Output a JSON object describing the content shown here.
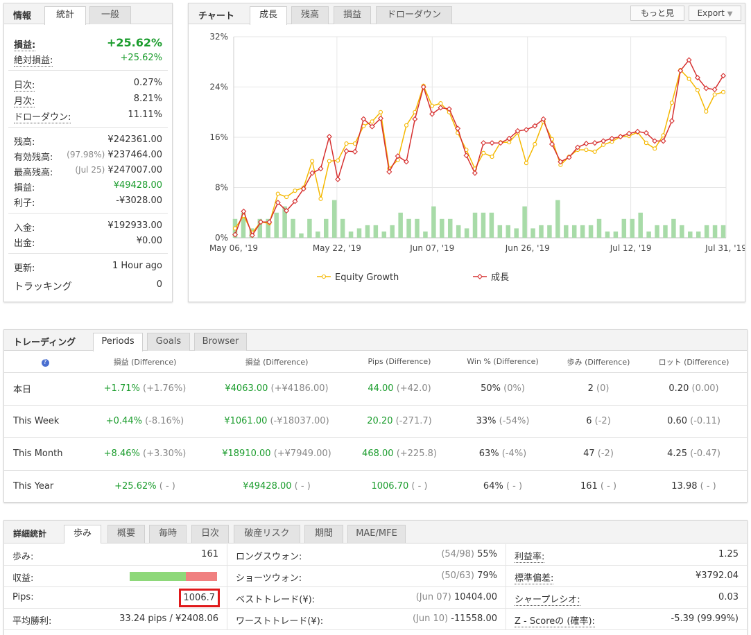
{
  "info": {
    "title": "情報",
    "tabs": [
      "統計",
      "一般"
    ],
    "gain_label": "損益:",
    "gain_value": "+25.62%",
    "abs_gain_label": "絶対損益:",
    "abs_gain_value": "+25.62%",
    "daily_label": "日次:",
    "daily_value": "0.27%",
    "monthly_label": "月次:",
    "monthly_value": "8.21%",
    "drawdown_label": "ドローダウン:",
    "drawdown_value": "11.11%",
    "balance_label": "残高:",
    "balance_value": "¥242361.00",
    "equity_label": "有効残高:",
    "equity_note": "(97.98%)",
    "equity_value": "¥237464.00",
    "highest_label": "最高残高:",
    "highest_note": "(Jul 25)",
    "highest_value": "¥247007.00",
    "profit_label": "損益:",
    "profit_value": "¥49428.00",
    "interest_label": "利子:",
    "interest_value": "-¥3028.00",
    "deposits_label": "入金:",
    "deposits_value": "¥192933.00",
    "withdrawals_label": "出金:",
    "withdrawals_value": "¥0.00",
    "updated_label": "更新:",
    "updated_value": "1 Hour ago",
    "tracking_label": "トラッキング",
    "tracking_value": "0"
  },
  "chart_panel": {
    "title": "チャート",
    "tabs": [
      "成長",
      "残高",
      "損益",
      "ドローダウン"
    ],
    "more_label": "もっと見",
    "export_label": "Export",
    "export_arrow": "▼"
  },
  "chart_data": {
    "type": "line",
    "ylim": [
      0,
      32
    ],
    "yticks": [
      "0%",
      "8%",
      "16%",
      "24%",
      "32%"
    ],
    "xtick_labels": [
      "May 06, '19",
      "May 22, '19",
      "Jun 07, '19",
      "Jun 26, '19",
      "Jul 12, '19",
      "Jul 31, '19"
    ],
    "xtick_index": [
      0,
      13,
      25,
      37,
      50,
      62
    ],
    "point_count": 63,
    "series": [
      {
        "name": "Equity Growth",
        "color": "#f5b800",
        "values": [
          1.5,
          3.5,
          0.8,
          2.5,
          2.3,
          7,
          6.5,
          7.5,
          8,
          12.2,
          6.2,
          12.2,
          12.3,
          15,
          15,
          17.8,
          18.5,
          20,
          11,
          12.4,
          17.9,
          20,
          24.2,
          21,
          21.4,
          20,
          16.7,
          14,
          11,
          13.5,
          12.9,
          15.2,
          15.2,
          16.7,
          11.9,
          14.9,
          18.5,
          15.7,
          11.6,
          12.9,
          14,
          14,
          13.7,
          14.8,
          15.3,
          16.1,
          16.2,
          16.8,
          15.1,
          14.2,
          16.3,
          21.5,
          26.7,
          25.3,
          23.5,
          20.1,
          22.8,
          23.2
        ]
      },
      {
        "name": "成長",
        "color": "#d63030",
        "values": [
          0.5,
          4.2,
          0.4,
          2.5,
          2.5,
          5.6,
          4.3,
          5.8,
          7.8,
          10.3,
          11,
          16.1,
          9.3,
          13.8,
          13.7,
          18.9,
          17.7,
          19,
          10.5,
          13,
          12.1,
          18.9,
          24,
          19.7,
          20.7,
          20.5,
          17.4,
          13.1,
          10.3,
          15.1,
          15.1,
          15.1,
          15.8,
          17,
          17.2,
          17.8,
          18.9,
          14.9,
          12.1,
          12.8,
          14.4,
          15,
          15.1,
          15.4,
          15.8,
          16.1,
          16.6,
          16.9,
          16.7,
          15.4,
          15.4,
          18.6,
          26.6,
          28.3,
          25.5,
          23.8,
          23.6,
          25.8
        ]
      }
    ],
    "bars": {
      "color": "#a8dba8",
      "values": [
        3,
        4,
        1.5,
        3,
        3,
        4,
        5,
        3,
        0.7,
        3,
        1,
        3,
        6,
        3,
        1,
        1.5,
        2,
        2,
        1,
        2,
        4,
        3,
        3,
        1,
        5,
        3,
        3,
        2,
        1.5,
        4,
        4,
        4,
        2,
        2,
        1.5,
        5,
        1.5,
        2,
        2,
        6,
        2,
        2,
        2,
        2,
        3,
        1,
        1,
        3,
        3,
        4,
        1,
        2,
        2,
        3,
        2,
        1,
        1,
        2,
        2,
        2
      ]
    }
  },
  "trading": {
    "title": "トレーディング",
    "tabs": [
      "Periods",
      "Goals",
      "Browser"
    ],
    "help": "?",
    "headers": [
      "損益 (Difference)",
      "損益 (Difference)",
      "Pips (Difference)",
      "Win % (Difference)",
      "歩み (Difference)",
      "ロット (Difference)"
    ],
    "rows": [
      {
        "label": "本日",
        "cells": [
          [
            "+1.71%",
            "(+1.76%)"
          ],
          [
            "¥4063.00",
            "(+¥4186.00)"
          ],
          [
            "44.00",
            "(+42.0)"
          ],
          [
            "50%",
            "(0%)"
          ],
          [
            "2",
            "(0)"
          ],
          [
            "0.20",
            "(0.00)"
          ]
        ]
      },
      {
        "label": "This Week",
        "cells": [
          [
            "+0.44%",
            "(-8.16%)"
          ],
          [
            "¥1061.00",
            "(-¥18037.00)"
          ],
          [
            "20.20",
            "(-271.7)"
          ],
          [
            "33%",
            "(-54%)"
          ],
          [
            "6",
            "(-2)"
          ],
          [
            "0.60",
            "(-0.11)"
          ]
        ]
      },
      {
        "label": "This Month",
        "cells": [
          [
            "+8.46%",
            "(+3.30%)"
          ],
          [
            "¥18910.00",
            "(+¥7949.00)"
          ],
          [
            "468.00",
            "(+225.8)"
          ],
          [
            "63%",
            "(-4%)"
          ],
          [
            "47",
            "(-2)"
          ],
          [
            "4.25",
            "(-0.47)"
          ]
        ]
      },
      {
        "label": "This Year",
        "cells": [
          [
            "+25.62%",
            "( - )"
          ],
          [
            "¥49428.00",
            "( - )"
          ],
          [
            "1006.70",
            "( - )"
          ],
          [
            "64%",
            "( - )"
          ],
          [
            "161",
            "( - )"
          ],
          [
            "13.98",
            "( - )"
          ]
        ]
      }
    ]
  },
  "detail": {
    "title": "詳細統計",
    "tabs": [
      "歩み",
      "概要",
      "毎時",
      "日次",
      "破産リスク",
      "期間",
      "MAE/MFE"
    ],
    "trades_label": "歩み:",
    "trades_value": "161",
    "profitability_label": "収益:",
    "profitability_win_pct": 64,
    "pips_label": "Pips:",
    "pips_value": "1006.7",
    "avg_win_label": "平均勝利:",
    "avg_win_value": "33.24 pips / ¥2408.06",
    "longs_label": "ロングスウォン:",
    "longs_note": "(54/98)",
    "longs_value": "55%",
    "shorts_label": "ショーツウォン:",
    "shorts_note": "(50/63)",
    "shorts_value": "79%",
    "best_label": "ベストトレード(¥):",
    "best_note": "(Jun 07)",
    "best_value": "10404.00",
    "worst_label": "ワーストトレード(¥):",
    "worst_note": "(Jun 10)",
    "worst_value": "-11558.00",
    "pf_label": "利益率:",
    "pf_value": "1.25",
    "sd_label": "標準偏差:",
    "sd_value": "¥3792.04",
    "sharpe_label": "シャープレシオ:",
    "sharpe_value": "0.03",
    "z_label": "Z - Scoreの (確率):",
    "z_value": "-5.39 (99.99%)"
  }
}
